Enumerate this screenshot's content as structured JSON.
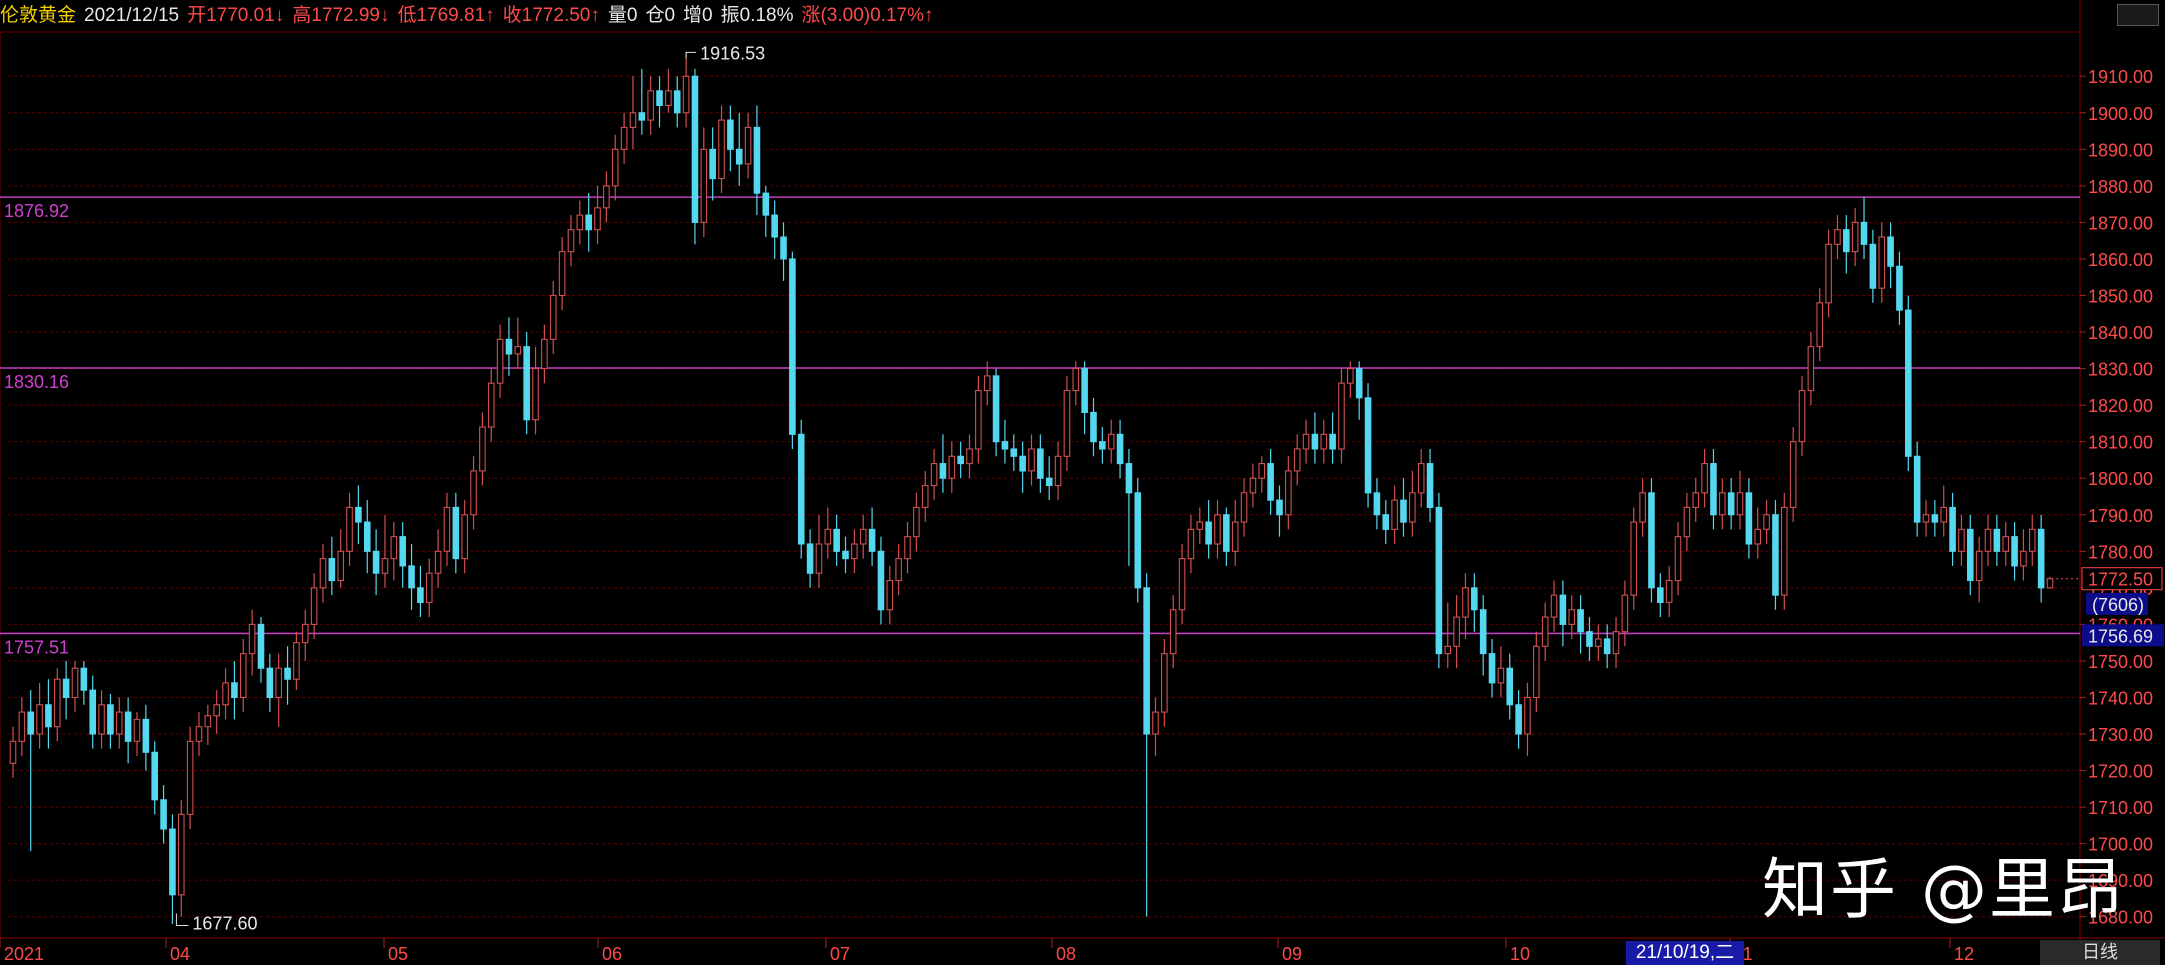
{
  "header": {
    "symbol": "伦敦黄金",
    "date": "2021/12/15",
    "open": "开1770.01↓",
    "high": "高1772.99↓",
    "low": "低1769.81↑",
    "close": "收1772.50↑",
    "volume": "量0",
    "position": "仓0",
    "increase": "增0",
    "amplitude": "振0.18%",
    "change": "涨(3.00)0.17%↑"
  },
  "colors": {
    "background": "#000000",
    "up": "#d05050",
    "down": "#54d8f0",
    "level_line": "#c040c0",
    "axis_text": "#ff4a4a",
    "grid": "#5a0000"
  },
  "chart_data": {
    "type": "candlestick",
    "y_axis": {
      "min": 1675,
      "max": 1918,
      "side": "right",
      "ticks": [
        "1910.00",
        "1900.00",
        "1890.00",
        "1880.00",
        "1870.00",
        "1860.00",
        "1850.00",
        "1840.00",
        "1830.00",
        "1820.00",
        "1810.00",
        "1800.00",
        "1790.00",
        "1780.00",
        "1770.00",
        "1760.00",
        "1750.00",
        "1740.00",
        "1730.00",
        "1720.00",
        "1710.00",
        "1700.00",
        "1690.00",
        "1680.00"
      ]
    },
    "x_axis": {
      "labels": [
        "2021",
        "04",
        "05",
        "06",
        "07",
        "08",
        "09",
        "10",
        "11",
        "12"
      ]
    },
    "levels": [
      {
        "label": "1876.92",
        "value": 1876.92
      },
      {
        "label": "1830.16",
        "value": 1830.16
      },
      {
        "label": "1757.51",
        "value": 1757.51
      }
    ],
    "price_tags": [
      {
        "label": "1772.50",
        "value": 1772.5,
        "style": "current"
      },
      {
        "label": "(7606)",
        "value": 1765.6,
        "style": "count"
      },
      {
        "label": "1756.69",
        "value": 1757.0,
        "style": "blue"
      }
    ],
    "annotations": [
      {
        "label": "1916.53",
        "value": 1916.53,
        "type": "high"
      },
      {
        "label": "1677.60",
        "value": 1677.6,
        "type": "low"
      }
    ],
    "crosshair_date": "21/10/19,二",
    "period": "日线",
    "watermark": "知乎 @里昂",
    "candles": [
      [
        1722,
        1728,
        1718,
        1732
      ],
      [
        1728,
        1736,
        1724,
        1740
      ],
      [
        1736,
        1730,
        1698,
        1742
      ],
      [
        1730,
        1738,
        1726,
        1744
      ],
      [
        1738,
        1732,
        1726,
        1745
      ],
      [
        1732,
        1745,
        1728,
        1748
      ],
      [
        1745,
        1740,
        1734,
        1750
      ],
      [
        1740,
        1748,
        1736,
        1750
      ],
      [
        1748,
        1742,
        1738,
        1750
      ],
      [
        1742,
        1730,
        1726,
        1746
      ],
      [
        1730,
        1738,
        1726,
        1742
      ],
      [
        1738,
        1730,
        1726,
        1741
      ],
      [
        1730,
        1736,
        1726,
        1740
      ],
      [
        1736,
        1728,
        1722,
        1740
      ],
      [
        1728,
        1734,
        1724,
        1736
      ],
      [
        1734,
        1725,
        1720,
        1738
      ],
      [
        1725,
        1712,
        1708,
        1728
      ],
      [
        1712,
        1704,
        1700,
        1716
      ],
      [
        1704,
        1686,
        1678,
        1708
      ],
      [
        1686,
        1708,
        1680,
        1712
      ],
      [
        1708,
        1728,
        1704,
        1732
      ],
      [
        1728,
        1732,
        1724,
        1736
      ],
      [
        1732,
        1735,
        1727,
        1738
      ],
      [
        1735,
        1738,
        1730,
        1742
      ],
      [
        1738,
        1744,
        1734,
        1748
      ],
      [
        1744,
        1740,
        1734,
        1750
      ],
      [
        1740,
        1752,
        1736,
        1756
      ],
      [
        1752,
        1760,
        1746,
        1764
      ],
      [
        1760,
        1748,
        1744,
        1762
      ],
      [
        1748,
        1740,
        1736,
        1752
      ],
      [
        1740,
        1748,
        1732,
        1752
      ],
      [
        1748,
        1745,
        1738,
        1754
      ],
      [
        1745,
        1755,
        1742,
        1758
      ],
      [
        1755,
        1760,
        1750,
        1764
      ],
      [
        1760,
        1770,
        1756,
        1774
      ],
      [
        1770,
        1778,
        1766,
        1782
      ],
      [
        1778,
        1772,
        1768,
        1784
      ],
      [
        1772,
        1780,
        1770,
        1786
      ],
      [
        1780,
        1792,
        1776,
        1796
      ],
      [
        1792,
        1788,
        1782,
        1798
      ],
      [
        1788,
        1780,
        1774,
        1794
      ],
      [
        1780,
        1774,
        1768,
        1786
      ],
      [
        1774,
        1778,
        1770,
        1790
      ],
      [
        1778,
        1784,
        1772,
        1788
      ],
      [
        1784,
        1776,
        1770,
        1788
      ],
      [
        1776,
        1770,
        1764,
        1782
      ],
      [
        1770,
        1766,
        1762,
        1776
      ],
      [
        1766,
        1774,
        1762,
        1778
      ],
      [
        1774,
        1780,
        1770,
        1786
      ],
      [
        1780,
        1792,
        1776,
        1796
      ],
      [
        1792,
        1778,
        1774,
        1796
      ],
      [
        1778,
        1790,
        1774,
        1794
      ],
      [
        1790,
        1802,
        1786,
        1806
      ],
      [
        1802,
        1814,
        1798,
        1818
      ],
      [
        1814,
        1826,
        1810,
        1830
      ],
      [
        1826,
        1838,
        1822,
        1842
      ],
      [
        1838,
        1834,
        1828,
        1844
      ],
      [
        1834,
        1836,
        1830,
        1844
      ],
      [
        1836,
        1816,
        1812,
        1840
      ],
      [
        1816,
        1830,
        1812,
        1836
      ],
      [
        1830,
        1838,
        1826,
        1842
      ],
      [
        1838,
        1850,
        1834,
        1854
      ],
      [
        1850,
        1862,
        1846,
        1866
      ],
      [
        1862,
        1868,
        1858,
        1872
      ],
      [
        1868,
        1872,
        1864,
        1876
      ],
      [
        1872,
        1868,
        1862,
        1878
      ],
      [
        1868,
        1874,
        1864,
        1880
      ],
      [
        1874,
        1880,
        1870,
        1884
      ],
      [
        1880,
        1890,
        1876,
        1894
      ],
      [
        1890,
        1896,
        1886,
        1900
      ],
      [
        1896,
        1900,
        1890,
        1910
      ],
      [
        1900,
        1898,
        1894,
        1912
      ],
      [
        1898,
        1906,
        1894,
        1910
      ],
      [
        1906,
        1902,
        1896,
        1910
      ],
      [
        1902,
        1906,
        1900,
        1912
      ],
      [
        1906,
        1900,
        1896,
        1910
      ],
      [
        1900,
        1910,
        1896,
        1916.53
      ],
      [
        1910,
        1870,
        1864,
        1912
      ],
      [
        1870,
        1890,
        1866,
        1896
      ],
      [
        1890,
        1882,
        1876,
        1896
      ],
      [
        1882,
        1898,
        1878,
        1902
      ],
      [
        1898,
        1890,
        1884,
        1902
      ],
      [
        1890,
        1886,
        1880,
        1900
      ],
      [
        1886,
        1896,
        1882,
        1900
      ],
      [
        1896,
        1878,
        1872,
        1902
      ],
      [
        1878,
        1872,
        1866,
        1880
      ],
      [
        1872,
        1866,
        1860,
        1876
      ],
      [
        1866,
        1860,
        1854,
        1870
      ],
      [
        1860,
        1812,
        1808,
        1862
      ],
      [
        1812,
        1782,
        1778,
        1816
      ],
      [
        1782,
        1774,
        1770,
        1786
      ],
      [
        1774,
        1782,
        1770,
        1790
      ],
      [
        1782,
        1786,
        1778,
        1792
      ],
      [
        1786,
        1780,
        1776,
        1790
      ],
      [
        1780,
        1778,
        1774,
        1784
      ],
      [
        1778,
        1782,
        1774,
        1786
      ],
      [
        1782,
        1786,
        1778,
        1790
      ],
      [
        1786,
        1780,
        1776,
        1792
      ],
      [
        1780,
        1764,
        1760,
        1784
      ],
      [
        1764,
        1772,
        1760,
        1776
      ],
      [
        1772,
        1778,
        1768,
        1782
      ],
      [
        1778,
        1784,
        1774,
        1788
      ],
      [
        1784,
        1792,
        1780,
        1796
      ],
      [
        1792,
        1798,
        1788,
        1802
      ],
      [
        1798,
        1804,
        1794,
        1808
      ],
      [
        1804,
        1800,
        1796,
        1812
      ],
      [
        1800,
        1806,
        1796,
        1810
      ],
      [
        1806,
        1804,
        1800,
        1810
      ],
      [
        1804,
        1808,
        1800,
        1812
      ],
      [
        1808,
        1824,
        1804,
        1828
      ],
      [
        1824,
        1828,
        1820,
        1832
      ],
      [
        1828,
        1810,
        1806,
        1830
      ],
      [
        1810,
        1808,
        1804,
        1816
      ],
      [
        1808,
        1806,
        1802,
        1812
      ],
      [
        1806,
        1802,
        1796,
        1810
      ],
      [
        1802,
        1808,
        1798,
        1812
      ],
      [
        1808,
        1800,
        1796,
        1812
      ],
      [
        1800,
        1798,
        1794,
        1806
      ],
      [
        1798,
        1806,
        1794,
        1810
      ],
      [
        1806,
        1824,
        1802,
        1828
      ],
      [
        1824,
        1830,
        1820,
        1832
      ],
      [
        1830,
        1818,
        1812,
        1832
      ],
      [
        1818,
        1810,
        1806,
        1822
      ],
      [
        1810,
        1808,
        1804,
        1814
      ],
      [
        1808,
        1812,
        1804,
        1816
      ],
      [
        1812,
        1804,
        1800,
        1816
      ],
      [
        1804,
        1796,
        1776,
        1808
      ],
      [
        1796,
        1770,
        1766,
        1800
      ],
      [
        1770,
        1730,
        1680,
        1774
      ],
      [
        1730,
        1736,
        1724,
        1740
      ],
      [
        1736,
        1752,
        1732,
        1756
      ],
      [
        1752,
        1764,
        1748,
        1768
      ],
      [
        1764,
        1778,
        1760,
        1782
      ],
      [
        1778,
        1786,
        1774,
        1790
      ],
      [
        1786,
        1788,
        1782,
        1792
      ],
      [
        1788,
        1782,
        1778,
        1794
      ],
      [
        1782,
        1790,
        1778,
        1794
      ],
      [
        1790,
        1780,
        1776,
        1792
      ],
      [
        1780,
        1788,
        1776,
        1794
      ],
      [
        1788,
        1796,
        1784,
        1800
      ],
      [
        1796,
        1800,
        1792,
        1804
      ],
      [
        1800,
        1804,
        1796,
        1806
      ],
      [
        1804,
        1794,
        1790,
        1808
      ],
      [
        1794,
        1790,
        1784,
        1798
      ],
      [
        1790,
        1802,
        1786,
        1806
      ],
      [
        1802,
        1808,
        1798,
        1812
      ],
      [
        1808,
        1812,
        1804,
        1816
      ],
      [
        1812,
        1808,
        1804,
        1818
      ],
      [
        1808,
        1812,
        1804,
        1816
      ],
      [
        1812,
        1808,
        1804,
        1818
      ],
      [
        1808,
        1826,
        1804,
        1830
      ],
      [
        1826,
        1830,
        1822,
        1832
      ],
      [
        1830,
        1822,
        1816,
        1832
      ],
      [
        1822,
        1796,
        1792,
        1826
      ],
      [
        1796,
        1790,
        1786,
        1800
      ],
      [
        1790,
        1786,
        1782,
        1794
      ],
      [
        1786,
        1794,
        1782,
        1798
      ],
      [
        1794,
        1788,
        1784,
        1800
      ],
      [
        1788,
        1796,
        1784,
        1802
      ],
      [
        1796,
        1804,
        1792,
        1808
      ],
      [
        1804,
        1792,
        1788,
        1808
      ],
      [
        1792,
        1752,
        1748,
        1796
      ],
      [
        1752,
        1754,
        1748,
        1766
      ],
      [
        1754,
        1762,
        1748,
        1768
      ],
      [
        1762,
        1770,
        1756,
        1774
      ],
      [
        1770,
        1764,
        1758,
        1774
      ],
      [
        1764,
        1752,
        1746,
        1768
      ],
      [
        1752,
        1744,
        1740,
        1756
      ],
      [
        1744,
        1748,
        1740,
        1754
      ],
      [
        1748,
        1738,
        1734,
        1752
      ],
      [
        1738,
        1730,
        1726,
        1742
      ],
      [
        1730,
        1740,
        1724,
        1744
      ],
      [
        1740,
        1754,
        1736,
        1758
      ],
      [
        1754,
        1762,
        1750,
        1766
      ],
      [
        1762,
        1768,
        1758,
        1772
      ],
      [
        1768,
        1760,
        1754,
        1772
      ],
      [
        1760,
        1764,
        1756,
        1768
      ],
      [
        1764,
        1758,
        1752,
        1768
      ],
      [
        1758,
        1754,
        1750,
        1762
      ],
      [
        1754,
        1756,
        1750,
        1760
      ],
      [
        1756,
        1752,
        1748,
        1760
      ],
      [
        1752,
        1758,
        1748,
        1762
      ],
      [
        1758,
        1768,
        1754,
        1772
      ],
      [
        1768,
        1788,
        1764,
        1792
      ],
      [
        1788,
        1796,
        1784,
        1800
      ],
      [
        1796,
        1770,
        1766,
        1800
      ],
      [
        1770,
        1766,
        1762,
        1774
      ],
      [
        1766,
        1772,
        1762,
        1776
      ],
      [
        1772,
        1784,
        1768,
        1788
      ],
      [
        1784,
        1792,
        1780,
        1796
      ],
      [
        1792,
        1796,
        1788,
        1800
      ],
      [
        1796,
        1804,
        1792,
        1808
      ],
      [
        1804,
        1790,
        1786,
        1808
      ],
      [
        1790,
        1796,
        1786,
        1800
      ],
      [
        1796,
        1790,
        1786,
        1800
      ],
      [
        1790,
        1796,
        1786,
        1802
      ],
      [
        1796,
        1782,
        1778,
        1800
      ],
      [
        1782,
        1786,
        1778,
        1792
      ],
      [
        1786,
        1790,
        1782,
        1794
      ],
      [
        1790,
        1768,
        1764,
        1794
      ],
      [
        1768,
        1792,
        1764,
        1796
      ],
      [
        1792,
        1810,
        1788,
        1814
      ],
      [
        1810,
        1824,
        1806,
        1828
      ],
      [
        1824,
        1836,
        1820,
        1840
      ],
      [
        1836,
        1848,
        1832,
        1852
      ],
      [
        1848,
        1864,
        1844,
        1868
      ],
      [
        1864,
        1868,
        1860,
        1872
      ],
      [
        1868,
        1862,
        1856,
        1872
      ],
      [
        1862,
        1870,
        1858,
        1874
      ],
      [
        1870,
        1864,
        1860,
        1876.92
      ],
      [
        1864,
        1852,
        1848,
        1868
      ],
      [
        1852,
        1866,
        1848,
        1870
      ],
      [
        1866,
        1858,
        1852,
        1870
      ],
      [
        1858,
        1846,
        1842,
        1862
      ],
      [
        1846,
        1806,
        1802,
        1850
      ],
      [
        1806,
        1788,
        1784,
        1810
      ],
      [
        1788,
        1790,
        1784,
        1794
      ],
      [
        1790,
        1788,
        1784,
        1794
      ],
      [
        1788,
        1792,
        1784,
        1798
      ],
      [
        1792,
        1780,
        1776,
        1796
      ],
      [
        1780,
        1786,
        1776,
        1790
      ],
      [
        1786,
        1772,
        1768,
        1790
      ],
      [
        1772,
        1780,
        1766,
        1784
      ],
      [
        1780,
        1786,
        1776,
        1790
      ],
      [
        1786,
        1780,
        1776,
        1790
      ],
      [
        1780,
        1784,
        1776,
        1788
      ],
      [
        1784,
        1776,
        1772,
        1788
      ],
      [
        1776,
        1780,
        1772,
        1786
      ],
      [
        1780,
        1786,
        1776,
        1790
      ],
      [
        1786,
        1770,
        1766,
        1790
      ],
      [
        1770,
        1772.5,
        1769.81,
        1772.99
      ]
    ]
  }
}
